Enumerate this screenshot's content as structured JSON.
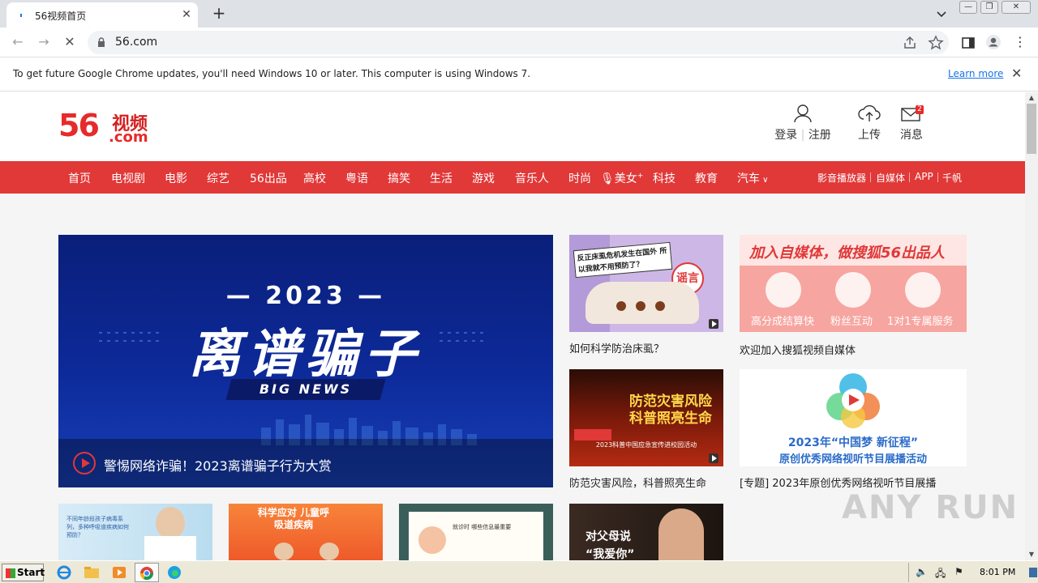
{
  "browser": {
    "tab_title": "56视频首页",
    "url": "56.com"
  },
  "infobar": {
    "message": "To get future Google Chrome updates, you'll need Windows 10 or later. This computer is using Windows 7.",
    "learn_more": "Learn more"
  },
  "header": {
    "logo_number": "56",
    "logo_text": "视频",
    "logo_domain": ".com",
    "login": "登录",
    "register": "注册",
    "upload": "上传",
    "messages": "消息",
    "message_count": "2"
  },
  "nav": {
    "items": [
      "首页",
      "电视剧",
      "电影",
      "综艺",
      "56出品",
      "高校",
      "粤语",
      "搞笑",
      "生活",
      "游戏",
      "音乐人",
      "时尚",
      "美女",
      "科技",
      "教育",
      "汽车"
    ],
    "right": [
      "影音播放器",
      "自媒体",
      "APP",
      "千帆"
    ]
  },
  "hero": {
    "year": "— 2023 —",
    "headline": "离谱骗子",
    "tag": "BIG NEWS",
    "caption": "警惕网络诈骗！2023离谱骗子行为大赏"
  },
  "cards": [
    {
      "caption": "如何科学防治床虱？",
      "thumb_text": "反正床虱危机发生在国外 所以我就不用预防了？",
      "thumb_badge": "谣言"
    },
    {
      "caption": "欢迎加入搜狐视频自媒体",
      "thumb_title": "加入自媒体，做搜狐56出品人",
      "features": [
        "高分成结算快",
        "粉丝互动",
        "1对1专属服务"
      ]
    },
    {
      "caption": "防范灾害风险，科普照亮生命",
      "thumb_text": "防范灾害风险 科普照亮生命",
      "thumb_sub": "2023科普中国应急宣传进校园活动"
    },
    {
      "caption": "[专题] 2023年原创优秀网络视听节目展播",
      "thumb_text": "2023年“中国梦 新征程”",
      "thumb_sub": "原创优秀网络视听节目展播活动"
    }
  ],
  "bottom_cards": [
    {
      "thumb_text": "不同年龄段孩子病毒系列，多种呼吸道疾病如何预防？"
    },
    {
      "thumb_text": "科学应对 儿童呼吸道疾病"
    },
    {
      "thumb_text": "就诊时 哪些信息最重要"
    },
    {
      "thumb_text": "对父母说 “我爱你”"
    }
  ],
  "watermark": "ANY RUN",
  "taskbar": {
    "start": "Start",
    "clock": "8:01 PM"
  },
  "colors": {
    "brand_red": "#e13838",
    "hero_blue": "#0d2a9a"
  }
}
